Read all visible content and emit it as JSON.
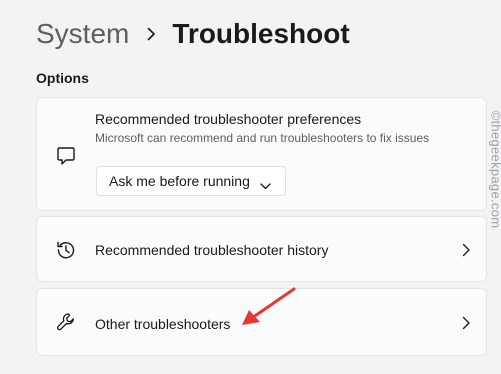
{
  "breadcrumb": {
    "parent": "System",
    "current": "Troubleshoot"
  },
  "section": {
    "title": "Options"
  },
  "preferences": {
    "title": "Recommended troubleshooter preferences",
    "description": "Microsoft can recommend and run troubleshooters to fix issues",
    "dropdown_value": "Ask me before running",
    "icon": "chat-bubble-icon"
  },
  "history": {
    "title": "Recommended troubleshooter history",
    "icon": "history-icon"
  },
  "other": {
    "title": "Other troubleshooters",
    "icon": "wrench-icon"
  },
  "watermark": "©thegeekpage.com",
  "colors": {
    "annotation_arrow": "#e53935",
    "background": "#f3f3f3",
    "card": "#fbfbfb"
  }
}
